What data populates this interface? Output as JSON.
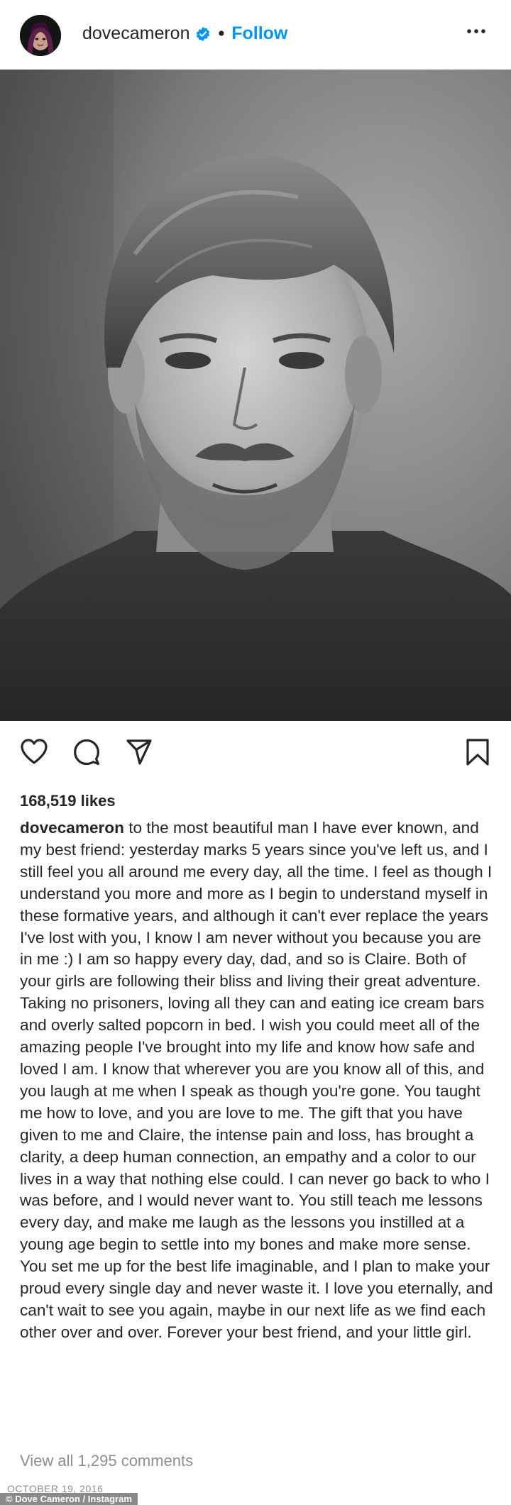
{
  "header": {
    "username": "dovecameron",
    "separator": "•",
    "follow_label": "Follow"
  },
  "post": {
    "likes": "168,519 likes",
    "caption_user": "dovecameron",
    "caption_text": "to the most beautiful man I have ever known, and my best friend: yesterday marks 5 years since you've left us, and I still feel you all around me every day, all the time. I feel as though I understand you more and more as I begin to understand myself in these formative years, and although it can't ever replace the years I've lost with you, I know I am never without you because you are in me :) I am so happy every day, dad, and so is Claire. Both of your girls are following their bliss and living their great adventure. Taking no prisoners, loving all they can and eating ice cream bars and overly salted popcorn in bed. I wish you could meet all of the amazing people I've brought into my life and know how safe and loved I am. I know that wherever you are you know all of this, and you laugh at me when I speak as though you're gone. You taught me how to love, and you are love to me. The gift that you have given to me and Claire, the intense pain and loss, has brought a clarity, a deep human connection, an empathy and a color to our lives in a way that nothing else could. I can never go back to who I was before, and I would never want to. You still teach me lessons every day, and make me laugh as the lessons you instilled at a young age begin to settle into my bones and make more sense. You set me up for the best life imaginable, and I plan to make your proud every single day and never waste it. I love you eternally, and can't wait to see you again, maybe in our next life as we find each other over and over. Forever your best friend, and your little girl.",
    "view_comments": "View all 1,295 comments",
    "date": "OCTOBER 19, 2016"
  },
  "credit": "© Dove Cameron / Instagram",
  "icons": {
    "verified": "verified-badge-icon",
    "more": "more-options-icon",
    "like": "heart-icon",
    "comment": "comment-icon",
    "share": "share-icon",
    "save": "bookmark-icon"
  },
  "colors": {
    "accent": "#0095f6",
    "text": "#262626",
    "muted": "#8e8e8e"
  }
}
